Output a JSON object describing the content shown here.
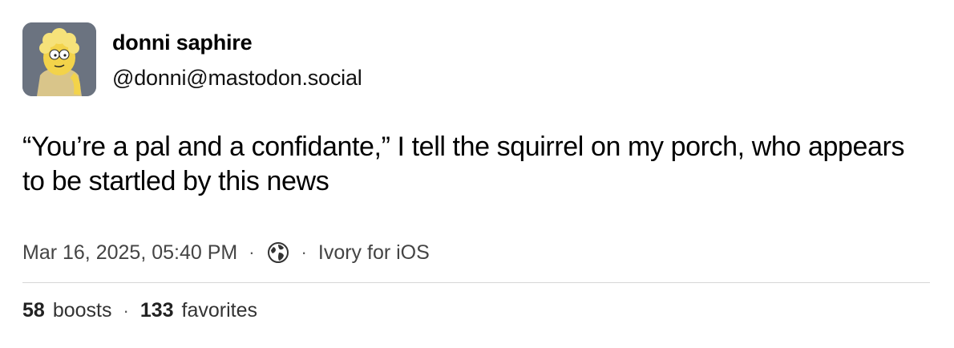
{
  "author": {
    "display_name": "donni saphire",
    "handle": "@donni@mastodon.social",
    "avatar": "avatar-icon"
  },
  "post": {
    "text": "“You’re a pal and a confidante,” I tell the squirrel on my porch, who appears to be startled by this news"
  },
  "meta": {
    "timestamp": "Mar 16, 2025, 05:40 PM",
    "separator": "·",
    "visibility_icon": "globe-icon",
    "client": "Ivory for iOS"
  },
  "stats": {
    "boosts_count": "58",
    "boosts_label": "boosts",
    "favorites_count": "133",
    "favorites_label": "favorites"
  }
}
